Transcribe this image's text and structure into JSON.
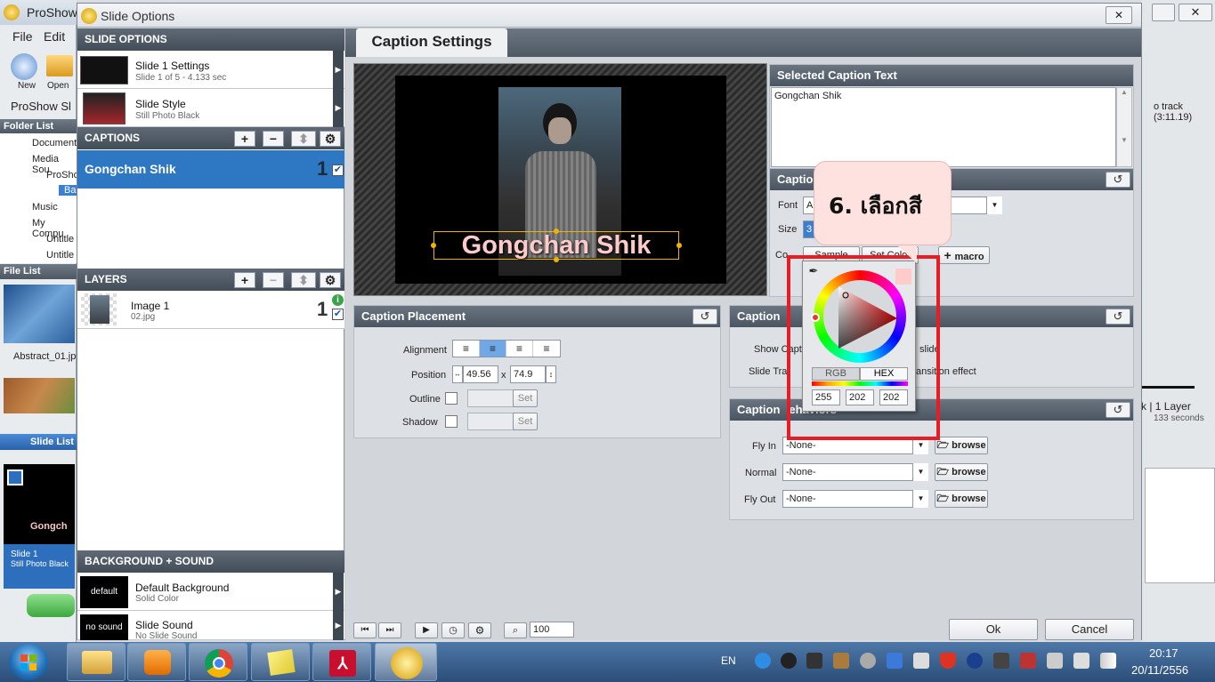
{
  "bg_app": {
    "title": "ProShow",
    "menu_file": "File",
    "menu_edit": "Edit",
    "tool_new": "New",
    "tool_open": "Open",
    "proshow_label": "ProShow Sl",
    "folder_list": "Folder List",
    "tree": [
      "Document",
      "Media Sou",
      "ProSho",
      "Ba",
      "Music",
      "My Compu",
      "Untitle",
      "Untitle"
    ],
    "file_list": "File List",
    "file_abstract": "Abstract_01.jp",
    "slide_list": "Slide List",
    "slide1_title": "Slide 1",
    "slide1_sub": "Still Photo Black",
    "slide1_caption": "Gongch",
    "right_track": "o track (3:11.19)",
    "right_layer": "k | 1 Layer",
    "right_seconds": "133 seconds"
  },
  "dialog": {
    "title": "Slide Options",
    "close": "✕",
    "slide_options_header": "SLIDE OPTIONS",
    "slide_settings_title": "Slide 1 Settings",
    "slide_settings_sub": "Slide 1 of 5 - 4.133 sec",
    "slide_style_title": "Slide Style",
    "slide_style_sub": "Still Photo Black",
    "captions_header": "CAPTIONS",
    "caption_item": "Gongchan Shik",
    "caption_number": "1",
    "layers_header": "LAYERS",
    "layer_title": "Image 1",
    "layer_sub": "02.jpg",
    "layer_number": "1",
    "bg_sound_header": "BACKGROUND + SOUND",
    "bg_thumb": "default",
    "bg_title": "Default Background",
    "bg_sub": "Solid Color",
    "sound_thumb": "no sound",
    "sound_title": "Slide Sound",
    "sound_sub": "No Slide Sound",
    "tab_caption_settings": "Caption Settings",
    "preview_caption": "Gongchan Shik",
    "selected_caption_header": "Selected Caption Text",
    "selected_caption_text": "Gongchan Shik",
    "caption_format_header": "Captio",
    "font_label": "Font",
    "font_value": "A",
    "size_label": "Size",
    "size_value": "3",
    "color_label": "Co",
    "color_btn1": "Sample",
    "color_btn2": "Set Color",
    "macro_label": "macro",
    "placement_header": "Caption Placement",
    "alignment_label": "Alignment",
    "position_label": "Position",
    "position_x": "49.56",
    "position_sep": "x",
    "position_y": "74.9",
    "outline_label": "Outline",
    "shadow_label": "Shadow",
    "set_label": "Set",
    "settings_header": "Caption",
    "show_caption_label": "Show Capt",
    "show_caption_suffix": "slide",
    "slide_transition_label": "Slide Tra",
    "slide_transition_suffix": "ansition effect",
    "behaviors_header": "Caption",
    "behaviors_header_suffix": "ehaviors",
    "fly_in_label": "Fly In",
    "fly_in_value": "-None-",
    "normal_label": "Normal",
    "normal_value": "-None-",
    "fly_out_label": "Fly Out",
    "fly_out_value": "-None-",
    "browse_label": "browse",
    "zoom_value": "100",
    "ok_label": "Ok",
    "cancel_label": "Cancel"
  },
  "color_picker": {
    "rgb_tab": "RGB",
    "hex_tab": "HEX",
    "r": "255",
    "g": "202",
    "b": "202",
    "selected_color": "#ffcaca"
  },
  "callout": {
    "text": "6. เลือกสี"
  },
  "taskbar": {
    "lang": "EN",
    "time": "20:17",
    "date": "20/11/2556"
  }
}
